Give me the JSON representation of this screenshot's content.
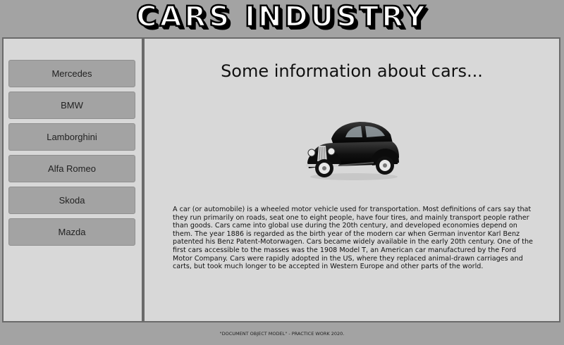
{
  "header": {
    "logo_text": "CARS INDUSTRY"
  },
  "sidebar": {
    "items": [
      {
        "label": "Mercedes"
      },
      {
        "label": "BMW"
      },
      {
        "label": "Lamborghini"
      },
      {
        "label": "Alfa Romeo"
      },
      {
        "label": "Skoda"
      },
      {
        "label": "Mazda"
      }
    ]
  },
  "main": {
    "title": "Some information about cars...",
    "image_icon": "vintage-car-icon",
    "description": "A car (or automobile) is a wheeled motor vehicle used for transportation. Most definitions of cars say that they run primarily on roads, seat one to eight people, have four tires, and mainly transport people rather than goods. Cars came into global use during the 20th century, and developed economies depend on them. The year 1886 is regarded as the birth year of the modern car when German inventor Karl Benz patented his Benz Patent-Motorwagen. Cars became widely available in the early 20th century. One of the first cars accessible to the masses was the 1908 Model T, an American car manufactured by the Ford Motor Company. Cars were rapidly adopted in the US, where they replaced animal-drawn carriages and carts, but took much longer to be accepted in Western Europe and other parts of the world."
  },
  "footer": {
    "text": "\"DOCUMENT OBJECT MODEL\" - PRACTICE WORK 2020."
  },
  "colors": {
    "page_background": "#a3a3a3",
    "panel_background": "#d8d8d8",
    "panel_border": "#6a6a6a",
    "button_background": "#a3a3a3"
  }
}
